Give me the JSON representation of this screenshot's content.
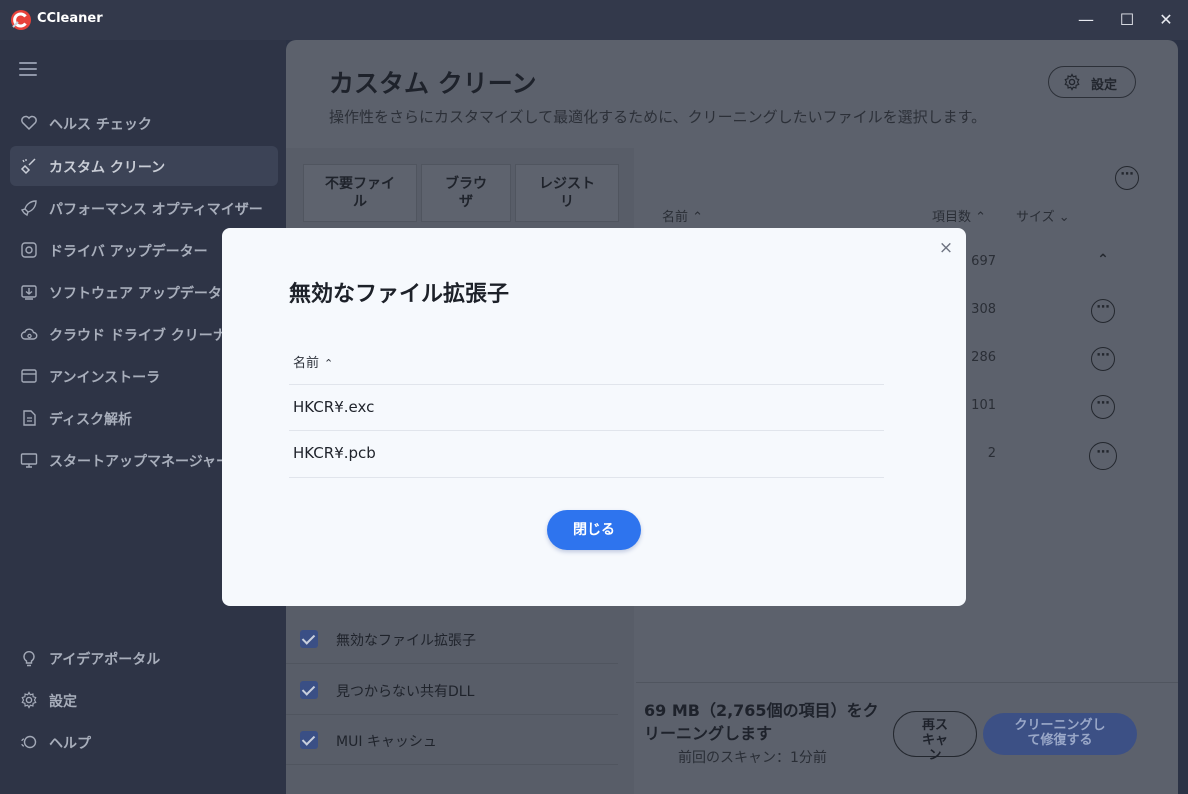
{
  "window": {
    "title": "CCleaner",
    "controls": {
      "minimize": "—",
      "maximize": "☐",
      "close": "✕"
    }
  },
  "sidebar": {
    "items": [
      {
        "label": "ヘルス チェック",
        "icon": "heart-icon"
      },
      {
        "label": "カスタム クリーン",
        "icon": "broom-icon",
        "active": true
      },
      {
        "label": "パフォーマンス オプティマイザー",
        "icon": "rocket-icon"
      },
      {
        "label": "ドライバ アップデーター",
        "icon": "driver-icon"
      },
      {
        "label": "ソフトウェア アップデーター",
        "icon": "download-icon"
      },
      {
        "label": "クラウド ドライブ クリーナー",
        "icon": "cloud-icon"
      },
      {
        "label": "アンインストーラ",
        "icon": "uninstall-icon"
      },
      {
        "label": "ディスク解析",
        "icon": "document-icon"
      },
      {
        "label": "スタートアップマネージャー",
        "icon": "monitor-icon"
      }
    ],
    "bottom_items": [
      {
        "label": "アイデアポータル",
        "icon": "lightbulb-icon"
      },
      {
        "label": "設定",
        "icon": "gear-icon"
      },
      {
        "label": "ヘルプ",
        "icon": "help-icon"
      }
    ]
  },
  "main": {
    "title": "カスタム クリーン",
    "subtitle": "操作性をさらにカスタマイズして最適化するために、クリーニングしたいファイルを選択します。",
    "settings_label": "設定",
    "tabs": [
      {
        "label_line1": "不要ファイ",
        "label_line2": "ル"
      },
      {
        "label_line1": "ブラウ",
        "label_line2": "ザ"
      },
      {
        "label_line1": "レジスト",
        "label_line2": "リ"
      }
    ],
    "checklist": [
      {
        "label": "無効なファイル拡張子",
        "checked": true
      },
      {
        "label": "見つからない共有DLL",
        "checked": true
      },
      {
        "label": "MUI キャッシュ",
        "checked": true
      }
    ],
    "results": {
      "columns": {
        "name": "名前",
        "items": "項目数",
        "size": "サイズ"
      },
      "counts": [
        "697",
        "308",
        "286",
        "101",
        "2"
      ]
    },
    "footer": {
      "summary": "69 MB（2,765個の項目）をクリーニングします",
      "last_scan": "前回のスキャン：1分前",
      "rescan_line1": "再ス",
      "rescan_line2": "キャ",
      "rescan_line3": "ン",
      "clean_line1": "クリーニングし",
      "clean_line2": "て修復する"
    }
  },
  "modal": {
    "title": "無効なファイル拡張子",
    "column_name": "名前",
    "rows": [
      "HKCR¥.exc",
      "HKCR¥.pcb"
    ],
    "close_button": "閉じる"
  },
  "colors": {
    "accent": "#2e74ee",
    "sidebar_bg": "#2e3446",
    "modal_bg": "#f6f9fd"
  }
}
